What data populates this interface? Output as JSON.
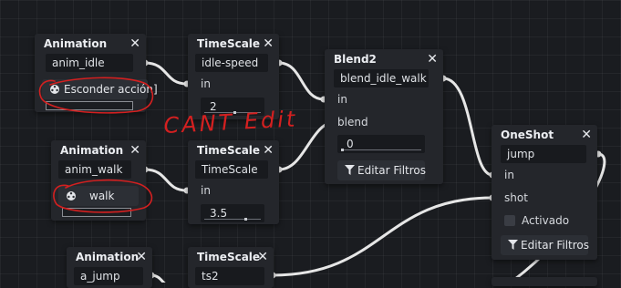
{
  "nodes": {
    "animation1": {
      "title": "Animation",
      "close": "✕",
      "anim_name": "anim_idle",
      "play_label": "Esconder acción]"
    },
    "timescale1": {
      "title": "TimeScale",
      "close": "✕",
      "name": "idle-speed",
      "in_label": "in",
      "scale_value": "2"
    },
    "blend2": {
      "title": "Blend2",
      "close": "✕",
      "name": "blend_idle_walk",
      "in_label": "in",
      "blend_label": "blend",
      "blend_value": "0",
      "filters_label": "Editar Filtros"
    },
    "animation2": {
      "title": "Animation",
      "close": "✕",
      "anim_name": "anim_walk",
      "play_label": "walk"
    },
    "timescale2": {
      "title": "TimeScale",
      "close": "✕",
      "name": "TimeScale",
      "in_label": "in",
      "scale_value": "3.5"
    },
    "oneshot": {
      "title": "OneShot",
      "close": "✕",
      "name": "jump",
      "in_label": "in",
      "shot_label": "shot",
      "active_label": "Activado",
      "active_checked": false,
      "filters_label": "Editar Filtros"
    },
    "animation3": {
      "title": "Animation",
      "close": "✕",
      "anim_name": "a_jump"
    },
    "timescale3": {
      "title": "TimeScale",
      "close": "✕",
      "name": "ts2"
    }
  },
  "annotation": {
    "text": "CANT Edit",
    "color": "#d42020"
  },
  "colors": {
    "wire": "#e6e6e6",
    "node_bg": "#24262b",
    "field_bg": "#181a1e",
    "canvas_bg": "#1a1c20"
  },
  "icons": {
    "animation_button": "film-reel-icon",
    "filter": "funnel-icon",
    "close": "close-icon"
  }
}
